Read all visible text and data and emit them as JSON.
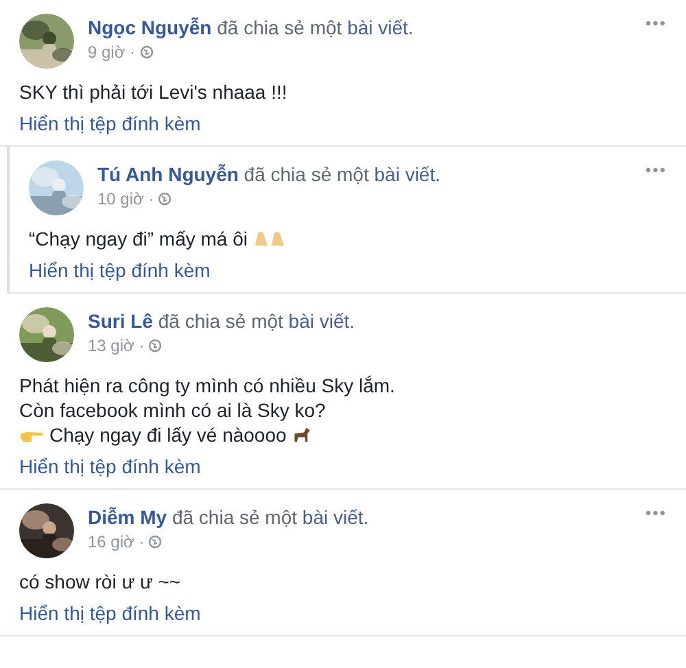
{
  "posts": [
    {
      "author": "Ngọc Nguyễn",
      "action": "đã chia sẻ một",
      "object": "bài viết.",
      "time": "9 giờ ·",
      "menu": "•••",
      "nested": false,
      "lines": [
        {
          "text": "SKY thì phải tới Levi's nhaaa !!!",
          "kind": "plain"
        }
      ],
      "attachment_link": "Hiển thị tệp đính kèm"
    },
    {
      "author": "Tú Anh Nguyễn",
      "action": "đã chia sẻ một",
      "object": "bài viết.",
      "time": "10 giờ ·",
      "menu": "•••",
      "nested": true,
      "lines": [
        {
          "text": "“Chạy ngay đi” mấy má ôi",
          "kind": "trailing_hands"
        }
      ],
      "attachment_link": "Hiển thị tệp đính kèm"
    },
    {
      "author": "Suri Lê",
      "action": "đã chia sẻ một",
      "object": "bài viết.",
      "time": "13 giờ ·",
      "nested": false,
      "lines": [
        {
          "text": "Phát hiện ra công ty mình có nhiều Sky lắm.",
          "kind": "plain"
        },
        {
          "text": "Còn facebook mình có ai là Sky ko?",
          "kind": "plain"
        },
        {
          "text": "Chạy ngay đi lấy vé nàoooo",
          "kind": "pointing_horse"
        }
      ],
      "attachment_link": "Hiển thị tệp đính kèm"
    },
    {
      "author": "Diễm My",
      "action": "đã chia sẻ một",
      "object": "bài viết.",
      "time": "16 giờ ·",
      "menu": "•••",
      "nested": false,
      "lines": [
        {
          "text": "có show ròi ư ư ~~",
          "kind": "plain"
        }
      ],
      "attachment_link": "Hiển thị tệp đính kèm"
    }
  ]
}
